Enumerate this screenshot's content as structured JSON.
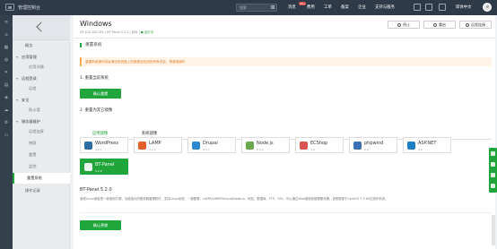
{
  "topbar": {
    "title": "管理控制台",
    "search_placeholder": "搜索",
    "messages_label": "消息",
    "messages_badge": "99+",
    "nav": [
      "费用",
      "工单",
      "备案",
      "企业",
      "支持与服务"
    ],
    "lang": "简体中文"
  },
  "sidebar": {
    "items": [
      {
        "label": "概览",
        "kind": "item"
      },
      {
        "label": "应用管理",
        "kind": "grp"
      },
      {
        "label": "应用详情",
        "kind": "sub"
      },
      {
        "label": "远程登录",
        "kind": "grp"
      },
      {
        "label": "远程",
        "kind": "sub"
      },
      {
        "label": "安全",
        "kind": "grp"
      },
      {
        "label": "防火墙",
        "kind": "sub"
      },
      {
        "label": "服务器维护",
        "kind": "grp"
      },
      {
        "label": "远程连接",
        "kind": "sub"
      },
      {
        "label": "快照",
        "kind": "sub"
      },
      {
        "label": "重置",
        "kind": "sub"
      },
      {
        "label": "监控",
        "kind": "sub"
      },
      {
        "label": "重置系统",
        "kind": "active"
      },
      {
        "label": "操作记录",
        "kind": "item"
      }
    ]
  },
  "app": {
    "name": "Windows",
    "meta_left": "39.100.100.201 | BT-Panel 5.2.0 | 包年 |",
    "meta_status": "● 运行中",
    "btn_stop": "停止",
    "btn_restart": "重启",
    "btn_remote": "远程连接"
  },
  "section": {
    "title": "重置系统",
    "warning": "重置系统操作将会清空系统盘上的数据及应用的所有内容，请谨慎操作",
    "step1": "1. 重置当前系统",
    "confirm1": "确认重置",
    "step2": "2. 重置为其它镜像",
    "tab_app": "应用镜像",
    "tab_sys": "系统镜像"
  },
  "images": [
    {
      "name": "WordPress",
      "ver": "4.9.1",
      "color": "#2f6ea5"
    },
    {
      "name": "LAMP",
      "ver": "5.1.0",
      "color": "#e55f2c"
    },
    {
      "name": "Drupal",
      "ver": "8.3.7",
      "color": "#2b88d2"
    },
    {
      "name": "Node.js",
      "ver": "8.9.4",
      "color": "#6aa84f"
    },
    {
      "name": "ECShop",
      "ver": "3.6",
      "color": "#d9534f"
    },
    {
      "name": "phpwind",
      "ver": "9.0",
      "color": "#3c6fb6"
    },
    {
      "name": "ASP.NET",
      "ver": "4.0",
      "color": "#1e7fc9"
    },
    {
      "name": "BT-Panel",
      "ver": "5.2.0",
      "color": "#ffffff",
      "selected": true
    }
  ],
  "detail": {
    "title": "BT-Panel 5.2.0",
    "desc": "宝塔Linux面板是一款使用方便、功能强大的服务器管理软件，支持Linux系统，一键配置：LAMP/LNMP/Tomcat/Node.js，网站、数据库、FTP、SSL，可以通过Web端轻松管理服务器，该镜像基于CentOS 7.3 64位操作系统。",
    "confirm2": "确认更换"
  }
}
